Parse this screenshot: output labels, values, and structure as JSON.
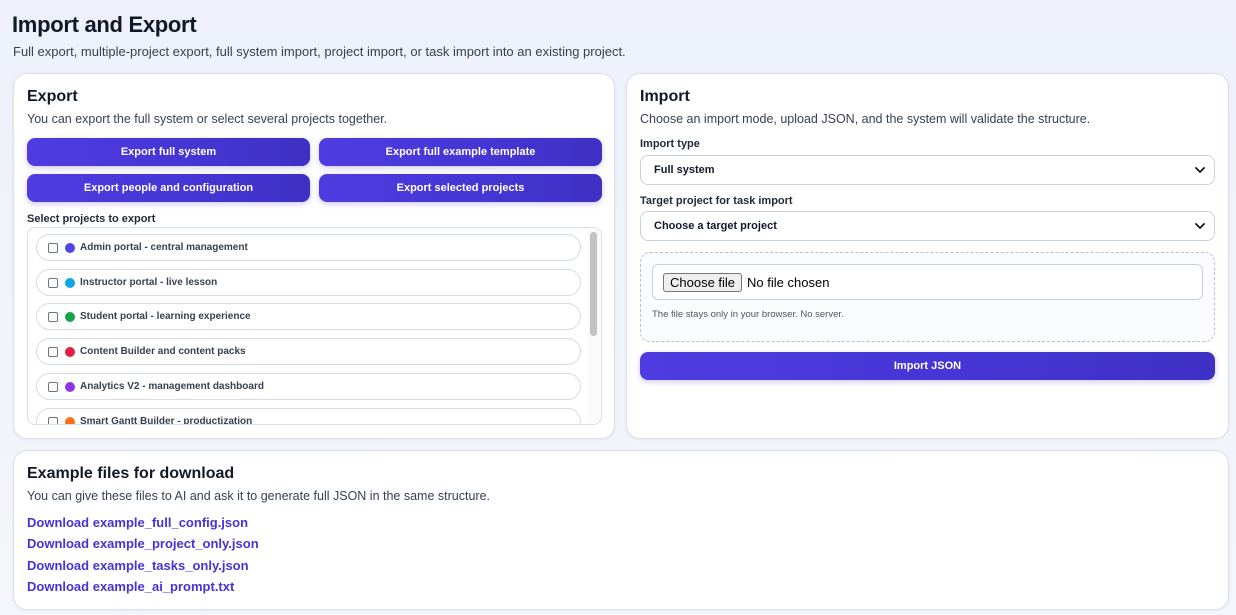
{
  "page": {
    "title": "Import and Export",
    "subtitle": "Full export, multiple-project export, full system import, project import, or task import into an existing project."
  },
  "export": {
    "title": "Export",
    "description": "You can export the full system or select several projects together.",
    "buttons": {
      "full_system": "Export full system",
      "full_template": "Export full example template",
      "people_config": "Export people and configuration",
      "selected_projects": "Export selected projects"
    },
    "select_label": "Select projects to export",
    "projects": [
      {
        "name": "Admin portal - central management",
        "color": "#4f46e5"
      },
      {
        "name": "Instructor portal - live lesson",
        "color": "#0ea5e9"
      },
      {
        "name": "Student portal - learning experience",
        "color": "#16a34a"
      },
      {
        "name": "Content Builder and content packs",
        "color": "#e11d48"
      },
      {
        "name": "Analytics V2 - management dashboard",
        "color": "#9333ea"
      },
      {
        "name": "Smart Gantt Builder - productization",
        "color": "#f97316"
      }
    ]
  },
  "import": {
    "title": "Import",
    "description": "Choose an import mode, upload JSON, and the system will validate the structure.",
    "type_label": "Import type",
    "type_value": "Full system",
    "target_label": "Target project for task import",
    "target_value": "Choose a target project",
    "choose_file_label": "Choose file",
    "file_status": "No file chosen",
    "file_note": "The file stays only in your browser. No server.",
    "import_button": "Import JSON"
  },
  "examples": {
    "title": "Example files for download",
    "description": "You can give these files to AI and ask it to generate full JSON in the same structure.",
    "links": [
      "Download example_full_config.json",
      "Download example_project_only.json",
      "Download example_tasks_only.json",
      "Download example_ai_prompt.txt"
    ]
  },
  "colors": {
    "accent": "#4f3ce0",
    "link": "#4533d8"
  }
}
